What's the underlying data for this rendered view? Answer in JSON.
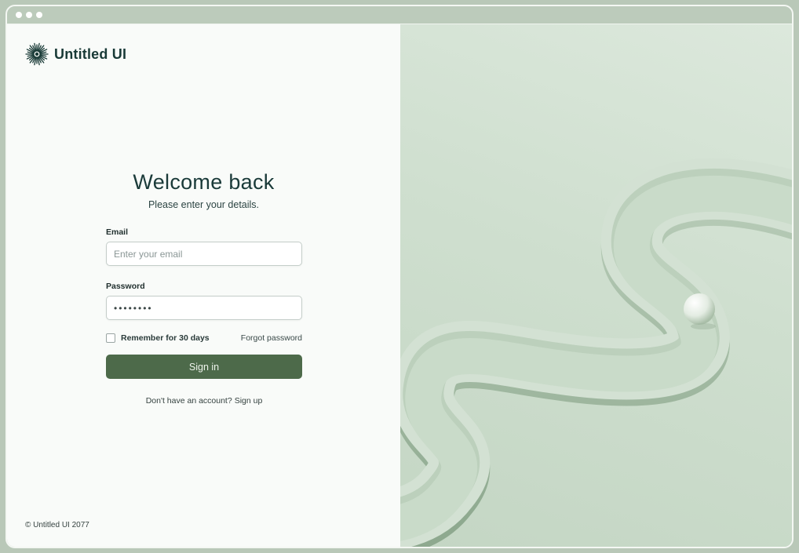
{
  "brand": {
    "name": "Untitled UI",
    "logo_icon": "sunburst-icon"
  },
  "heading": {
    "title": "Welcome back",
    "subtitle": "Please enter your details."
  },
  "form": {
    "email_label": "Email",
    "email_placeholder": "Enter your email",
    "password_label": "Password",
    "password_value": "••••••••",
    "remember_label": "Remember for 30 days",
    "forgot_label": "Forgot password",
    "submit_label": "Sign in"
  },
  "signup": {
    "prompt": "Don't have an account?",
    "link": "Sign up"
  },
  "footer": {
    "copyright": "© Untitled UI 2077"
  },
  "colors": {
    "accent": "#4d6a4a",
    "brand_text": "#193a37",
    "panel": "#f9fbf9",
    "art_bg": "#cfdfcf"
  }
}
